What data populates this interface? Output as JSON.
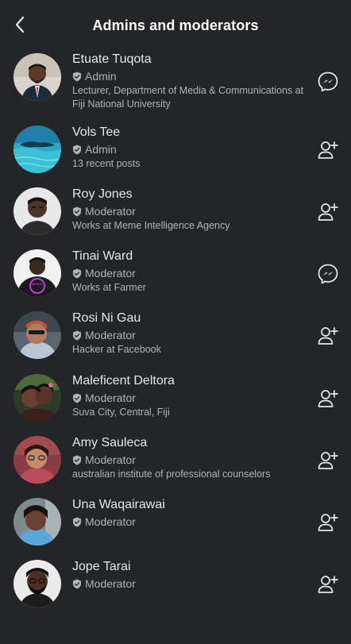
{
  "header": {
    "title": "Admins and moderators"
  },
  "members": [
    {
      "name": "Etuate Tuqota",
      "role": "Admin",
      "detail": "Lecturer, Department of Media & Communications at Fiji National University",
      "action_icon": "messenger-icon"
    },
    {
      "name": "Vols Tee",
      "role": "Admin",
      "detail": "13 recent posts",
      "action_icon": "add-friend-icon"
    },
    {
      "name": "Roy Jones",
      "role": "Moderator",
      "detail": "Works at Meme Intelligence Agency",
      "action_icon": "add-friend-icon"
    },
    {
      "name": "Tinai Ward",
      "role": "Moderator",
      "detail": "Works at Farmer",
      "action_icon": "messenger-icon"
    },
    {
      "name": "Rosi Ni Gau",
      "role": "Moderator",
      "detail": "Hacker at Facebook",
      "action_icon": "add-friend-icon"
    },
    {
      "name": "Maleficent Deltora",
      "role": "Moderator",
      "detail": "Suva City, Central, Fiji",
      "action_icon": "add-friend-icon"
    },
    {
      "name": "Amy Sauleca",
      "role": "Moderator",
      "detail": "australian institute of professional counselors",
      "action_icon": "add-friend-icon"
    },
    {
      "name": "Una Waqairawai",
      "role": "Moderator",
      "detail": "",
      "action_icon": "add-friend-icon"
    },
    {
      "name": "Jope Tarai",
      "role": "Moderator",
      "detail": "",
      "action_icon": "add-friend-icon"
    }
  ],
  "colors": {
    "background": "#242526",
    "primary_text": "#e4e6eb",
    "secondary_text": "#b0b3b8"
  }
}
